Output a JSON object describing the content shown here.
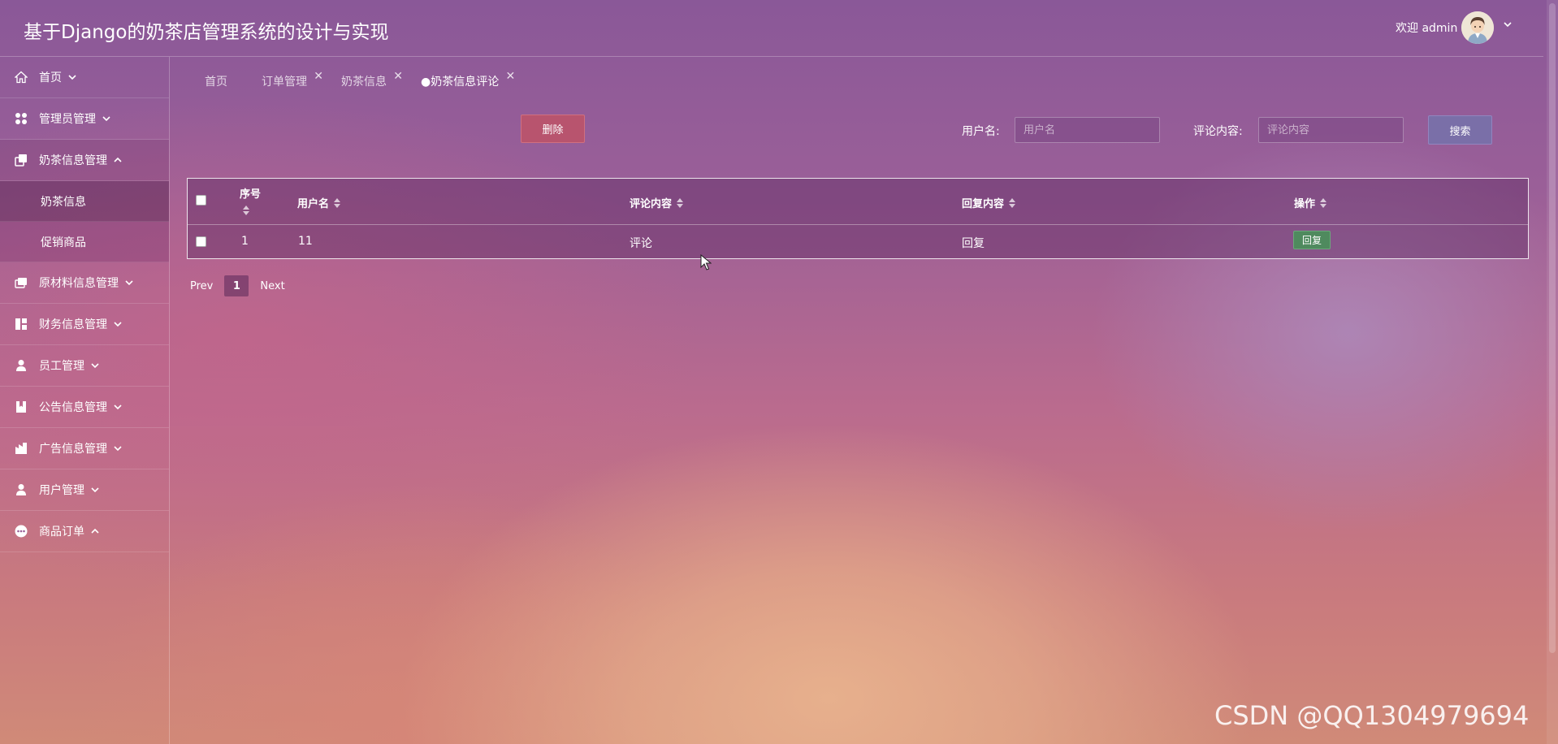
{
  "header": {
    "title": "基于Django的奶茶店管理系统的设计与实现",
    "welcome": "欢迎 admin",
    "avatar_icon": "user-avatar-icon"
  },
  "sidebar": {
    "items": [
      {
        "label": "首页",
        "icon": "home-icon",
        "caret": "down"
      },
      {
        "label": "管理员管理",
        "icon": "apps-icon",
        "caret": "down"
      },
      {
        "label": "奶茶信息管理",
        "icon": "copy-icon",
        "caret": "up",
        "open": true,
        "children": [
          {
            "label": "奶茶信息",
            "active": true
          },
          {
            "label": "促销商品"
          }
        ]
      },
      {
        "label": "原材料信息管理",
        "icon": "layers-icon",
        "caret": "down"
      },
      {
        "label": "财务信息管理",
        "icon": "dashboard-icon",
        "caret": "down"
      },
      {
        "label": "员工管理",
        "icon": "person-icon",
        "caret": "down"
      },
      {
        "label": "公告信息管理",
        "icon": "bookmark-icon",
        "caret": "down"
      },
      {
        "label": "广告信息管理",
        "icon": "building-icon",
        "caret": "down"
      },
      {
        "label": "用户管理",
        "icon": "user-icon",
        "caret": "down"
      },
      {
        "label": "商品订单",
        "icon": "more-icon",
        "caret": "up"
      }
    ]
  },
  "tabs": [
    {
      "label": "首页",
      "closable": false
    },
    {
      "label": "订单管理",
      "closable": true
    },
    {
      "label": "奶茶信息",
      "closable": true
    },
    {
      "label": "●奶茶信息评论",
      "closable": true,
      "active": true
    }
  ],
  "toolbar": {
    "delete_label": "删除",
    "username_label": "用户名:",
    "username_placeholder": "用户名",
    "comment_label": "评论内容:",
    "comment_placeholder": "评论内容",
    "search_label": "搜索"
  },
  "table": {
    "headers": [
      "序号",
      "用户名",
      "评论内容",
      "回复内容",
      "操作"
    ],
    "rows": [
      {
        "index": "1",
        "username": "11",
        "comment": "评论",
        "reply": "回复",
        "action": "回复"
      }
    ]
  },
  "pagination": {
    "prev": "Prev",
    "current": "1",
    "next": "Next"
  },
  "watermark": "CSDN @QQ1304979694",
  "colors": {
    "delete": "#b8546e",
    "search": "#7a6fa8",
    "reply": "#4f8a5e"
  }
}
